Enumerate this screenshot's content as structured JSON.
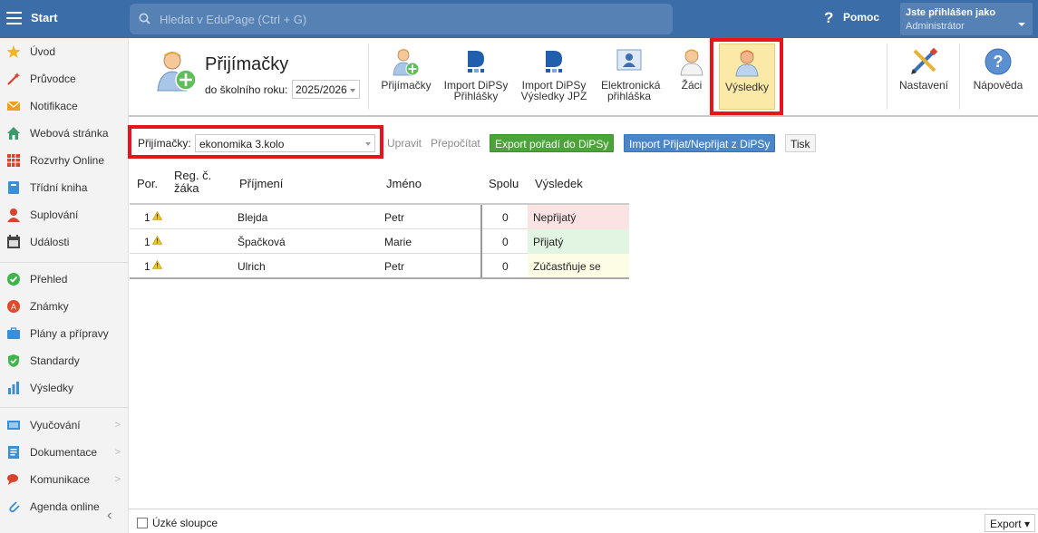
{
  "topbar": {
    "start_label": "Start",
    "search_placeholder": "Hledat v EduPage (Ctrl + G)",
    "help_label": "Pomoc",
    "login_line1": "Jste přihlášen jako",
    "login_line2": "Administrátor"
  },
  "sidebar": {
    "items": [
      {
        "label": "Úvod",
        "icon": "star-icon"
      },
      {
        "label": "Průvodce",
        "icon": "wand-icon"
      },
      {
        "label": "Notifikace",
        "icon": "envelope-icon"
      },
      {
        "label": "Webová stránka",
        "icon": "home-icon"
      },
      {
        "label": "Rozvrhy Online",
        "icon": "timetable-icon"
      },
      {
        "label": "Třídní kniha",
        "icon": "book-icon"
      },
      {
        "label": "Suplování",
        "icon": "substitute-icon"
      },
      {
        "label": "Události",
        "icon": "calendar-icon"
      },
      {
        "label": "Přehled",
        "icon": "check-circle-icon"
      },
      {
        "label": "Známky",
        "icon": "grades-icon"
      },
      {
        "label": "Plány a přípravy",
        "icon": "briefcase-icon"
      },
      {
        "label": "Standardy",
        "icon": "shield-icon"
      },
      {
        "label": "Výsledky",
        "icon": "bar-chart-icon"
      },
      {
        "label": "Vyučování",
        "icon": "teaching-icon"
      },
      {
        "label": "Dokumentace",
        "icon": "document-icon"
      },
      {
        "label": "Komunikace",
        "icon": "chat-icon"
      },
      {
        "label": "Agenda online",
        "icon": "paperclip-icon"
      }
    ]
  },
  "header": {
    "title": "Přijímačky",
    "year_prefix": "do školního roku:",
    "year_value": "2025/2026",
    "buttons": [
      {
        "label": "Přijímačky"
      },
      {
        "label": "Import DiPSy Přihlášky"
      },
      {
        "label": "Import DiPSy Výsledky JPZ"
      },
      {
        "label": "Elektronická přihláška"
      },
      {
        "label": "Žáci"
      },
      {
        "label": "Výsledky"
      },
      {
        "label": "Nastavení"
      },
      {
        "label": "Nápověda"
      }
    ]
  },
  "toolbar": {
    "filter_label": "Přijímačky:",
    "filter_value": "ekonomika 3.kolo",
    "edit_link": "Upravit",
    "recalc_link": "Přepočítat",
    "export_btn": "Export pořadí do DiPSy",
    "import_btn": "Import Přijat/Nepřijat z DiPSy",
    "print_btn": "Tisk"
  },
  "table": {
    "headers": {
      "order": "Por.",
      "reg": "Reg. č. žáka",
      "surname": "Příjmení",
      "name": "Jméno",
      "total": "Spolu",
      "result": "Výsledek"
    },
    "rows": [
      {
        "order": "1",
        "surname": "Blejda",
        "name": "Petr",
        "total": "0",
        "result": "Nepřijatý",
        "result_color": "#fbe3e3"
      },
      {
        "order": "1",
        "surname": "Špačková",
        "name": "Marie",
        "total": "0",
        "result": "Přijatý",
        "result_color": "#e2f5e2"
      },
      {
        "order": "1",
        "surname": "Ulrich",
        "name": "Petr",
        "total": "0",
        "result": "Zúčastňuje se",
        "result_color": "#fdfde6"
      }
    ]
  },
  "footer": {
    "narrow_columns_label": "Úzké sloupce",
    "export_label": "Export ▾"
  }
}
